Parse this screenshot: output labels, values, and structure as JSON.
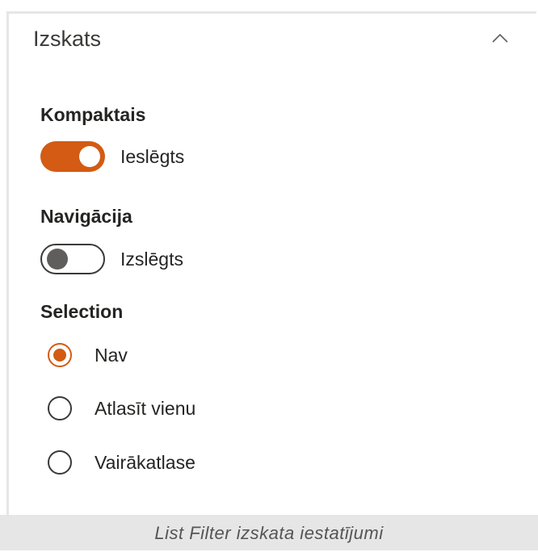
{
  "panel": {
    "title": "Izskats",
    "collapse_icon": "chevron-up-icon"
  },
  "compact": {
    "label": "Kompaktais",
    "state_text": "Ieslēgts",
    "checked": true
  },
  "navigation": {
    "label": "Navigācija",
    "state_text": "Izslēgts",
    "checked": false
  },
  "selection": {
    "label": "Selection",
    "options": [
      {
        "label": "Nav",
        "checked": true
      },
      {
        "label": "Atlasīt vienu",
        "checked": false
      },
      {
        "label": "Vairākatlase",
        "checked": false
      }
    ]
  },
  "caption": "List Filter izskata iestatījumi",
  "colors": {
    "accent": "#d35b13",
    "border": "#e6e6e6",
    "caption_bg": "#e6e6e6"
  }
}
